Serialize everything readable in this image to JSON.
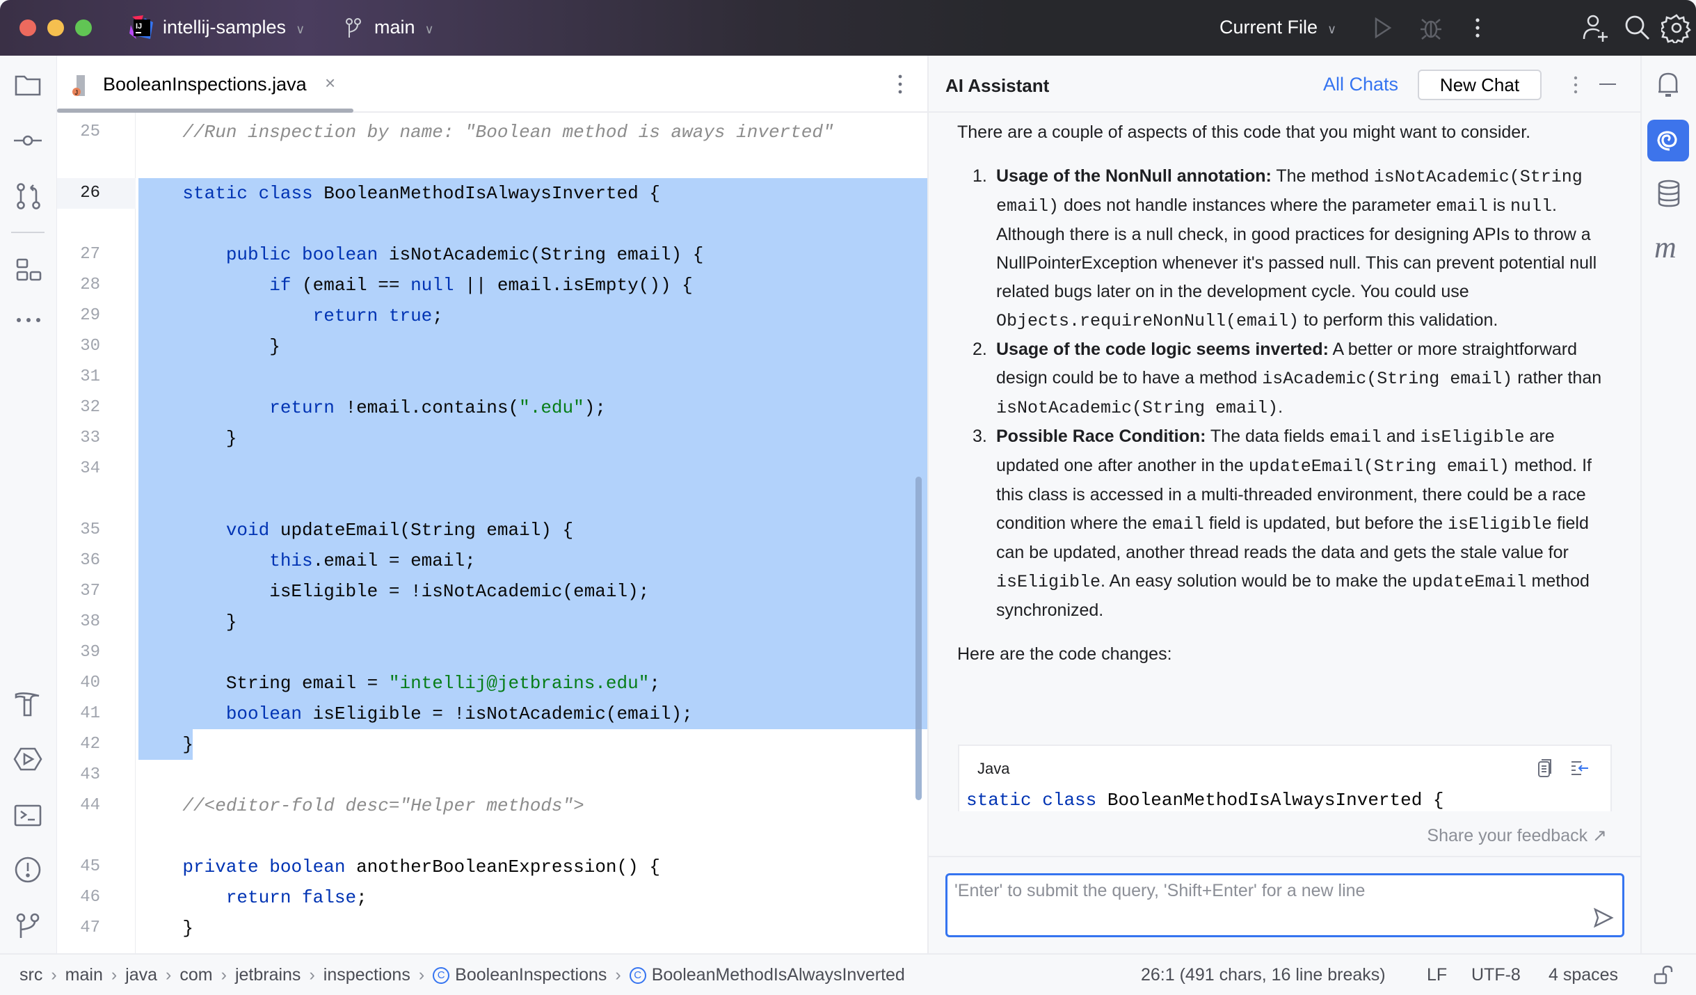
{
  "titlebar": {
    "project": "intellij-samples",
    "branch": "main",
    "run_config": "Current File",
    "colors": {
      "close": "#ed6a5e",
      "minimize": "#f5bf4f",
      "maximize": "#61c554"
    }
  },
  "editor": {
    "tab_label": "BooleanInspections.java",
    "lines": [
      {
        "n": "25",
        "tokens": [
          [
            "c",
            "    //Run inspection by name: \"Boolean method is aways inverted\""
          ]
        ]
      },
      {
        "n": "26",
        "tokens": [
          [
            "k",
            "    static"
          ],
          [
            "p",
            " "
          ],
          [
            "k",
            "class"
          ],
          [
            "p",
            " BooleanMethodIsAlwaysInverted {"
          ]
        ]
      },
      {
        "n": "27",
        "tokens": [
          [
            "k",
            "        public"
          ],
          [
            "p",
            " "
          ],
          [
            "k",
            "boolean"
          ],
          [
            "p",
            " isNotAcademic(String email) {"
          ]
        ]
      },
      {
        "n": "28",
        "tokens": [
          [
            "k",
            "            if"
          ],
          [
            "p",
            " (email == "
          ],
          [
            "k",
            "null"
          ],
          [
            "p",
            " || email.isEmpty()) {"
          ]
        ]
      },
      {
        "n": "29",
        "tokens": [
          [
            "k",
            "                return"
          ],
          [
            "p",
            " "
          ],
          [
            "k",
            "true"
          ],
          [
            "p",
            ";"
          ]
        ]
      },
      {
        "n": "30",
        "tokens": [
          [
            "p",
            "            }"
          ]
        ]
      },
      {
        "n": "31",
        "tokens": []
      },
      {
        "n": "32",
        "tokens": [
          [
            "k",
            "            return"
          ],
          [
            "p",
            " !email.contains("
          ],
          [
            "s",
            "\".edu\""
          ],
          [
            "p",
            ");"
          ]
        ]
      },
      {
        "n": "33",
        "tokens": [
          [
            "p",
            "        }"
          ]
        ]
      },
      {
        "n": "34",
        "tokens": []
      },
      {
        "n": "35",
        "tokens": [
          [
            "k",
            "        void"
          ],
          [
            "p",
            " updateEmail(String email) {"
          ]
        ]
      },
      {
        "n": "36",
        "tokens": [
          [
            "k",
            "            this"
          ],
          [
            "p",
            ".email = email;"
          ]
        ]
      },
      {
        "n": "37",
        "tokens": [
          [
            "p",
            "            isEligible = !isNotAcademic(email);"
          ]
        ]
      },
      {
        "n": "38",
        "tokens": [
          [
            "p",
            "        }"
          ]
        ]
      },
      {
        "n": "39",
        "tokens": []
      },
      {
        "n": "40",
        "tokens": [
          [
            "p",
            "        String email = "
          ],
          [
            "s",
            "\"intellij@jetbrains.edu\""
          ],
          [
            "p",
            ";"
          ]
        ]
      },
      {
        "n": "41",
        "tokens": [
          [
            "k",
            "        boolean"
          ],
          [
            "p",
            " isEligible = !isNotAcademic(email);"
          ]
        ]
      },
      {
        "n": "42",
        "tokens": [
          [
            "p",
            "    }"
          ]
        ]
      },
      {
        "n": "43",
        "tokens": []
      },
      {
        "n": "44",
        "tokens": [
          [
            "c",
            "    //<editor-fold desc=\"Helper methods\">"
          ]
        ]
      },
      {
        "n": "45",
        "tokens": [
          [
            "k",
            "    private"
          ],
          [
            "p",
            " "
          ],
          [
            "k",
            "boolean"
          ],
          [
            "p",
            " anotherBooleanExpression() {"
          ]
        ]
      },
      {
        "n": "46",
        "tokens": [
          [
            "k",
            "        return"
          ],
          [
            "p",
            " "
          ],
          [
            "k",
            "false"
          ],
          [
            "p",
            ";"
          ]
        ]
      },
      {
        "n": "47",
        "tokens": [
          [
            "p",
            "    }"
          ]
        ]
      }
    ],
    "selection_color": "#b2d2fb",
    "colors": {
      "keyword": "#0033b3",
      "string": "#067d17",
      "comment": "#8c8c8c"
    }
  },
  "ai": {
    "title": "AI Assistant",
    "all_chats": "All Chats",
    "new_chat": "New Chat",
    "intro": "There are a couple of aspects of this code that you might want to consider.",
    "items": [
      {
        "num": "1.",
        "segments": [
          [
            "b",
            "Usage of the NonNull annotation:"
          ],
          [
            "t",
            " The method "
          ],
          [
            "m",
            "isNotAcademic(String email)"
          ],
          [
            "t",
            " does not handle instances where the parameter "
          ],
          [
            "m",
            "email"
          ],
          [
            "t",
            " is "
          ],
          [
            "m",
            "null"
          ],
          [
            "t",
            ". Although there is a null check, in good practices for designing APIs to throw a NullPointerException whenever it's passed null. This can prevent potential null related bugs later on in the development cycle. You could use "
          ],
          [
            "m",
            "Objects.requireNonNull(email)"
          ],
          [
            "t",
            " to perform this validation."
          ]
        ]
      },
      {
        "num": "2.",
        "segments": [
          [
            "b",
            "Usage of the code logic seems inverted:"
          ],
          [
            "t",
            " A better or more straightforward design could be to have a method "
          ],
          [
            "m",
            "isAcademic(String email)"
          ],
          [
            "t",
            " rather than "
          ],
          [
            "m",
            "isNotAcademic(String email)"
          ],
          [
            "t",
            "."
          ]
        ]
      },
      {
        "num": "3.",
        "segments": [
          [
            "b",
            "Possible Race Condition:"
          ],
          [
            "t",
            " The data fields "
          ],
          [
            "m",
            "email"
          ],
          [
            "t",
            " and "
          ],
          [
            "m",
            "isEligible"
          ],
          [
            "t",
            " are updated one after another in the "
          ],
          [
            "m",
            "updateEmail(String email)"
          ],
          [
            "t",
            " method. If this class is accessed in a multi-threaded environment, there could be a race condition where the "
          ],
          [
            "m",
            "email"
          ],
          [
            "t",
            " field is updated, but before the "
          ],
          [
            "m",
            "isEligible"
          ],
          [
            "t",
            " field can be updated, another thread reads the data and gets the stale value for "
          ],
          [
            "m",
            "isEligible"
          ],
          [
            "t",
            ". An easy solution would be to make the "
          ],
          [
            "m",
            "updateEmail"
          ],
          [
            "t",
            " method synchronized."
          ]
        ]
      }
    ],
    "code_intro": "Here are the code changes:",
    "code_block": {
      "language": "Java",
      "tokens": [
        [
          "k",
          "static"
        ],
        [
          "p",
          " "
        ],
        [
          "k",
          "class"
        ],
        [
          "p",
          " BooleanMethodIsAlwaysInverted {"
        ]
      ]
    },
    "feedback": "Share your feedback ↗",
    "input_placeholder": "'Enter' to submit the query, 'Shift+Enter' for a new line",
    "accent": "#3574f0"
  },
  "statusbar": {
    "breadcrumbs": [
      "src",
      "main",
      "java",
      "com",
      "jetbrains",
      "inspections",
      "BooleanInspections",
      "BooleanMethodIsAlwaysInverted"
    ],
    "position": "26:1 (491 chars, 16 line breaks)",
    "line_ending": "LF",
    "encoding": "UTF-8",
    "indent": "4 spaces"
  }
}
